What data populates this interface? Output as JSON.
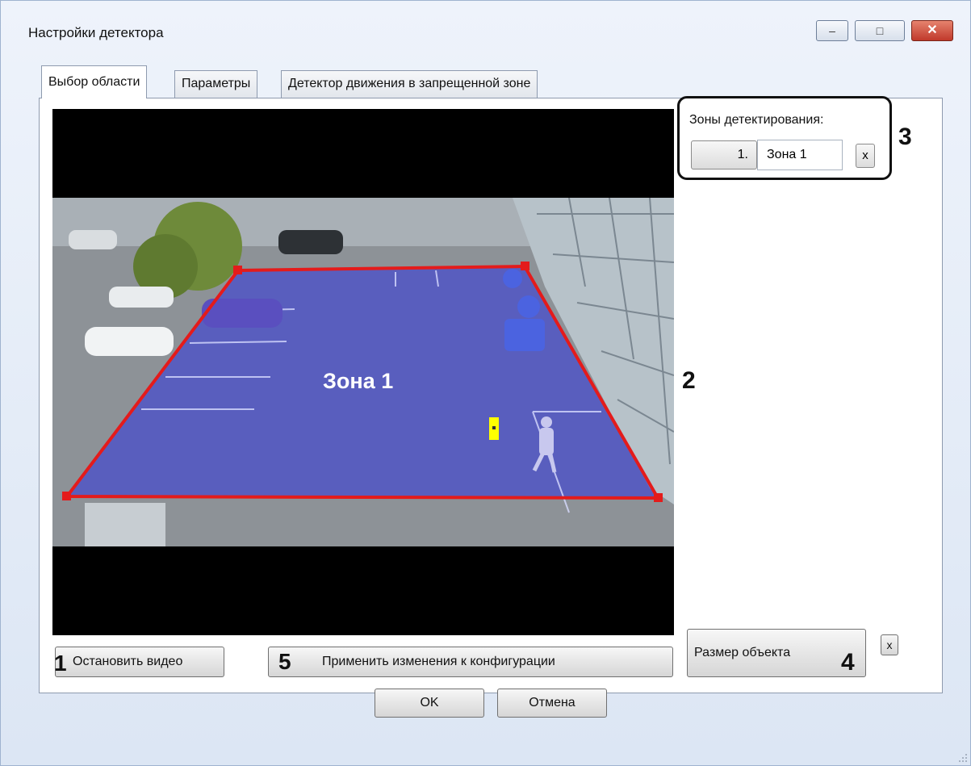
{
  "window": {
    "title": "Настройки детектора",
    "controls": {
      "minimize": "–",
      "maximize": "□",
      "close": "✕"
    }
  },
  "tabs": [
    {
      "label": "Выбор области",
      "selected": true
    },
    {
      "label": "Параметры",
      "selected": false
    },
    {
      "label": "Детектор движения в запрещенной зоне",
      "selected": false
    }
  ],
  "zones": {
    "group_label": "Зоны детектирования:",
    "items": [
      {
        "number_label": "1.",
        "name": "Зона 1",
        "delete_label": "x"
      }
    ]
  },
  "video": {
    "zone_overlay_label": "Зона 1",
    "zone_color": "#3a3fd6",
    "zone_border_color": "#e41b1b",
    "object_size_marker_color": "#ffff00"
  },
  "callouts": {
    "c1": "1",
    "c2": "2",
    "c3": "3",
    "c4": "4",
    "c5": "5"
  },
  "buttons": {
    "stop_video": "Остановить видео",
    "apply_config": "Применить изменения к конфигурации",
    "object_size": "Размер объекта",
    "object_size_delete": "x",
    "ok": "OK",
    "cancel": "Отмена"
  }
}
